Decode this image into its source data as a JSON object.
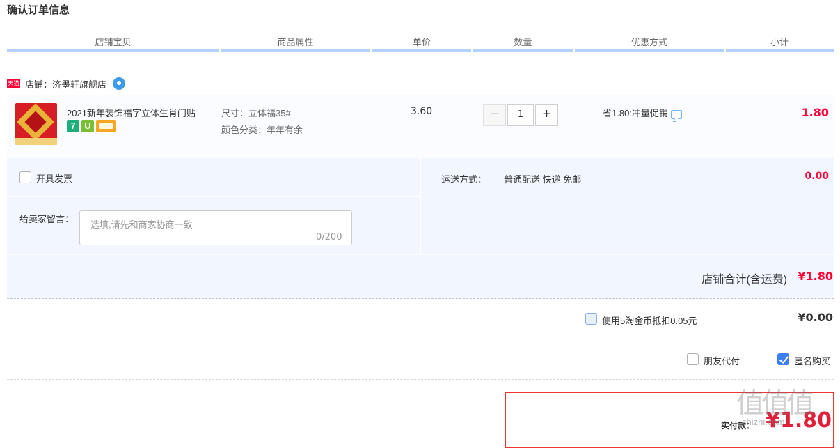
{
  "page": {
    "title": "确认订单信息"
  },
  "columns": [
    "店铺宝贝",
    "商品属性",
    "单价",
    "数量",
    "优惠方式",
    "小计"
  ],
  "shop": {
    "badge": "天猫",
    "label": "店铺：济墨轩旗舰店",
    "icon": "wangwang-chat-icon"
  },
  "item": {
    "title": "2021新年装饰福字立体生肖门贴",
    "service_icons": [
      "7-day-return-icon",
      "shield-icon",
      "card-icon"
    ],
    "service_7_text": "7",
    "attr_size": "尺寸：立体福35#",
    "attr_color": "颜色分类：年年有余",
    "unit_price": "3.60",
    "quantity": "1",
    "qty_minus": "−",
    "qty_plus": "+",
    "promo": "省1.80:冲量促销",
    "subtotal": "1.80"
  },
  "invoice": {
    "label": "开具发票",
    "checked": false
  },
  "message": {
    "label": "给卖家留言：",
    "placeholder": "选填,请先和商家协商一致",
    "counter": "0/200"
  },
  "shipping": {
    "label": "运送方式：",
    "method": "普通配送 快递 免邮",
    "fee": "0.00"
  },
  "shop_total": {
    "label": "店铺合计(含运费)",
    "value": "¥1.80"
  },
  "coins": {
    "label": "使用5淘金币抵扣0.05元",
    "value": "¥0.00",
    "checked": false
  },
  "options": {
    "friend_pay_label": "朋友代付",
    "friend_pay_checked": false,
    "anonymous_label": "匿名购买",
    "anonymous_checked": true
  },
  "payment": {
    "label": "实付款：",
    "value": "¥1.80"
  },
  "watermark": {
    "text": "值值值",
    "sub": "zhizhi.com"
  },
  "colors": {
    "accent_red": "#ff0036",
    "header_bar_blue": "#b2d1ff",
    "panel_bg": "#f2f7ff",
    "checkbox_blue": "#3d7ff3"
  }
}
